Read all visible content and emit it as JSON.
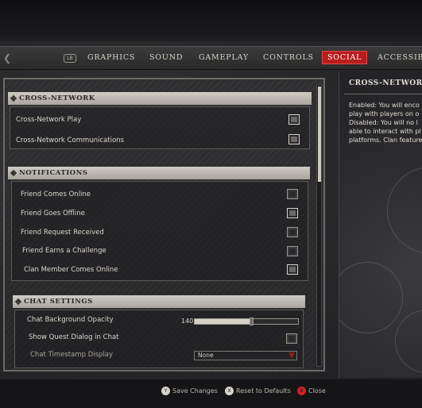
{
  "topnav": {
    "bumper_left": "LB",
    "tabs": [
      {
        "label": "GRAPHICS",
        "active": false
      },
      {
        "label": "SOUND",
        "active": false
      },
      {
        "label": "GAMEPLAY",
        "active": false
      },
      {
        "label": "CONTROLS",
        "active": false
      },
      {
        "label": "SOCIAL",
        "active": true
      },
      {
        "label": "ACCESSIBILI",
        "active": false
      }
    ],
    "active_color": "#b81c1c"
  },
  "sections": {
    "cross_network": {
      "title": "CROSS-NETWORK",
      "rows": [
        {
          "label": "Cross-Network Play",
          "checked": true
        },
        {
          "label": "Cross-Network Communications",
          "checked": true
        }
      ]
    },
    "notifications": {
      "title": "NOTIFICATIONS",
      "rows": [
        {
          "label": "Friend Comes Online",
          "checked": false
        },
        {
          "label": "Friend Goes Offline",
          "checked": true
        },
        {
          "label": "Friend Request Received",
          "checked": false
        },
        {
          "label": "Friend Earns a Challenge",
          "checked": false
        },
        {
          "label": "Clan Member Comes Online",
          "checked": true
        }
      ]
    },
    "chat": {
      "title": "CHAT SETTINGS",
      "opacity_label": "Chat Background Opacity",
      "opacity_value": "140",
      "opacity_fraction": 0.55,
      "quest_label": "Show Quest Dialog in Chat",
      "quest_checked": false,
      "timestamp_label": "Chat Timestamp Display",
      "timestamp_value": "None"
    }
  },
  "description": {
    "title": "CROSS-NETWORK",
    "lines": [
      "Enabled: You will enco",
      "play with players on o",
      "Disabled: You will no l",
      "able to interact with pl",
      "platforms. Clan feature"
    ]
  },
  "hints": [
    {
      "glyph": "Y",
      "label": "Save Changes",
      "color": "#d8d4cc"
    },
    {
      "glyph": "X",
      "label": "Reset to Defaults",
      "color": "#d8d4cc"
    },
    {
      "glyph": "B",
      "label": "Close",
      "color": "#d8202a"
    }
  ]
}
